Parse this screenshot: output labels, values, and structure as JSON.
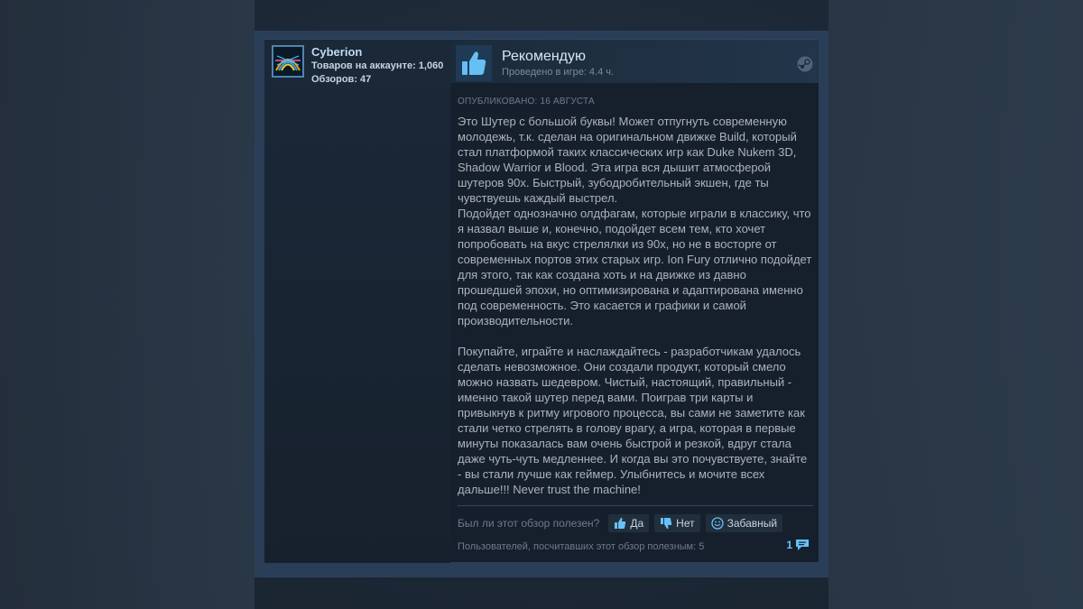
{
  "author": {
    "name": "Cyberion",
    "products_label": "Товаров на аккаунте:",
    "products_count": "1,060",
    "reviews_label": "Обзоров:",
    "reviews_count": "47"
  },
  "review": {
    "verdict": "Рекомендую",
    "hours": "Проведено в игре: 4.4 ч.",
    "posted": "Опубликовано: 16 августа",
    "paragraphs": [
      "Это Шутер с большой буквы! Может отпугнуть современную молодежь, т.к. сделан на оригинальном движке Build, который стал платформой таких классических игр как Duke Nukem 3D, Shadow Warrior и Blood. Эта игра вся дышит атмосферой шутеров 90х. Быстрый, зубодробительный экшен, где ты чувствуешь каждый выстрел.",
      "Подойдет однозначно олдфагам, которые играли в классику, что я назвал выше и, конечно, подойдет всем тем, кто хочет попробовать на вкус стрелялки из 90х, но не в восторге от современных портов этих старых игр. Ion Fury отлично подойдет для этого, так как создана хоть и на движке из давно прошедшей эпохи, но оптимизирована и адаптирована именно под современность. Это касается и графики и самой производительности.",
      "Покупайте, играйте и наслаждайтесь - разработчикам удалось сделать невозможное. Они создали продукт, который смело можно назвать шедевром. Чистый, настоящий, правильный - именно такой шутер перед вами. Поиграв три карты и привыкнув к ритму игрового процесса, вы сами не заметите как стали четко стрелять в голову врагу, а игра, которая в первые минуты показалась вам очень быстрой и резкой, вдруг стала даже чуть-чуть медленнее. И когда вы это почувствуете, знайте - вы стали лучше как геймер. Улыбнитесь и мочите всех дальше!!! Never trust the machine!"
    ]
  },
  "feedback": {
    "question": "Был ли этот обзор полезен?",
    "yes_label": "Да",
    "no_label": "Нет",
    "funny_label": "Забавный",
    "helpful_count_text": "Пользователей, посчитавших этот обзор полезным: 5",
    "comments_count": "1"
  },
  "icons": {
    "verdict": "thumbs-up-icon",
    "platform": "steam-icon",
    "yes": "thumbs-up-icon",
    "no": "thumbs-down-icon",
    "funny": "smiley-icon",
    "comments": "comment-bubble-icon"
  },
  "colors": {
    "link": "#67c1f5",
    "text": "#acb2b8",
    "panel": "#16202d",
    "frame": "#2a3f57"
  }
}
